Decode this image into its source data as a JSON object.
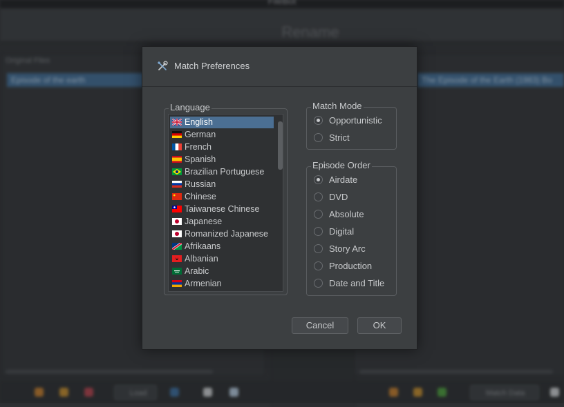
{
  "background": {
    "window_title": "FileBot",
    "header_title": "Rename",
    "original_files_label": "Original Files",
    "left_selected_row": "Episode of the earth",
    "right_selected_row": "The Episode of the Earth (1983) Bo",
    "load_label": "Load",
    "match_data_label": "Match Data"
  },
  "dialog": {
    "title": "Match Preferences",
    "icon": "wrench-screwdriver-icon",
    "language": {
      "legend": "Language",
      "selected": "English",
      "items": [
        {
          "label": "English",
          "flag": "uk-flag-icon"
        },
        {
          "label": "German",
          "flag": "de-flag-icon"
        },
        {
          "label": "French",
          "flag": "fr-flag-icon"
        },
        {
          "label": "Spanish",
          "flag": "es-flag-icon"
        },
        {
          "label": "Brazilian Portuguese",
          "flag": "br-flag-icon"
        },
        {
          "label": "Russian",
          "flag": "ru-flag-icon"
        },
        {
          "label": "Chinese",
          "flag": "cn-flag-icon"
        },
        {
          "label": "Taiwanese Chinese",
          "flag": "tw-flag-icon"
        },
        {
          "label": "Japanese",
          "flag": "jp-flag-icon"
        },
        {
          "label": "Romanized Japanese",
          "flag": "jp-flag-icon"
        },
        {
          "label": "Afrikaans",
          "flag": "na-flag-icon"
        },
        {
          "label": "Albanian",
          "flag": "al-flag-icon"
        },
        {
          "label": "Arabic",
          "flag": "sa-flag-icon"
        },
        {
          "label": "Armenian",
          "flag": "am-flag-icon"
        }
      ]
    },
    "match_mode": {
      "legend": "Match Mode",
      "selected": "Opportunistic",
      "options": [
        "Opportunistic",
        "Strict"
      ]
    },
    "episode_order": {
      "legend": "Episode Order",
      "selected": "Airdate",
      "options": [
        "Airdate",
        "DVD",
        "Absolute",
        "Digital",
        "Story Arc",
        "Production",
        "Date and Title"
      ]
    },
    "buttons": {
      "cancel": "Cancel",
      "ok": "OK"
    }
  },
  "colors": {
    "dialog_bg": "#3c3f41",
    "selection": "#4b6f93",
    "background_selection": "#3f6a92"
  }
}
